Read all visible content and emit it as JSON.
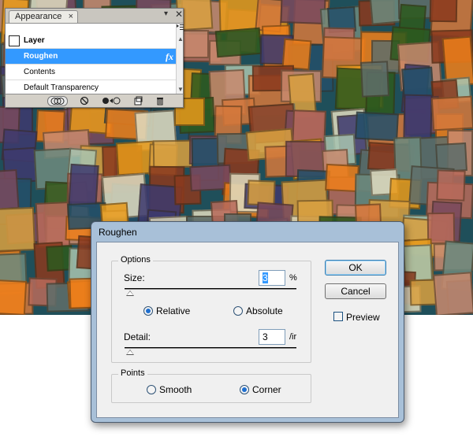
{
  "appearance_panel": {
    "tab_title": "Appearance",
    "tab_close_glyph": "×",
    "minimize_glyph": "▾",
    "close_glyph": "✕",
    "menu_glyph": "▸≡",
    "rows": {
      "layer": "Layer",
      "roughen": "Roughen",
      "contents": "Contents",
      "transparency": "Default Transparency"
    },
    "fx_glyph": "fx",
    "selected_row_color": "#3399ff",
    "toolbar_icons": [
      "display-circles-icon",
      "clear-icon",
      "reduce-icon",
      "duplicate-icon",
      "delete-icon"
    ]
  },
  "roughen_dialog": {
    "title": "Roughen",
    "options_legend": "Options",
    "size_label": "Size:",
    "size_value": "3",
    "size_unit": "%",
    "relative_label": "Relative",
    "absolute_label": "Absolute",
    "relative_selected": true,
    "detail_label": "Detail:",
    "detail_value": "3",
    "detail_unit": "/ir",
    "points_legend": "Points",
    "smooth_label": "Smooth",
    "corner_label": "Corner",
    "corner_selected": true,
    "ok_label": "OK",
    "cancel_label": "Cancel",
    "preview_label": "Preview",
    "preview_checked": false
  },
  "artwork": {
    "palette": [
      "#8b3a1e",
      "#d4783c",
      "#6d8a7e",
      "#3e3a6e",
      "#e89a1a",
      "#2d5a1e",
      "#c98a6e",
      "#5f6e6a",
      "#ef7f1a",
      "#a8c4b0",
      "#7a4a5e",
      "#d9a040",
      "#24506a",
      "#b86a5a",
      "#e0dcc0"
    ]
  }
}
